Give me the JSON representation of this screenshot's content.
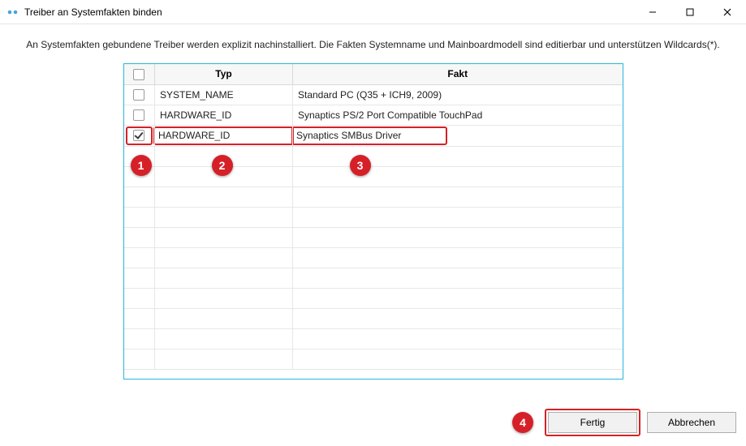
{
  "window": {
    "title": "Treiber an Systemfakten binden"
  },
  "description": "An Systemfakten gebundene Treiber werden explizit nachinstalliert. Die Fakten Systemname und Mainboardmodell sind editierbar und unterstützen Wildcards(*).",
  "columns": {
    "typ": "Typ",
    "fakt": "Fakt"
  },
  "rows": [
    {
      "checked": false,
      "typ": "SYSTEM_NAME",
      "fakt": "Standard PC (Q35 + ICH9, 2009)"
    },
    {
      "checked": false,
      "typ": "HARDWARE_ID",
      "fakt": "Synaptics PS/2 Port Compatible TouchPad"
    },
    {
      "checked": true,
      "typ": "HARDWARE_ID",
      "fakt": "Synaptics SMBus Driver"
    }
  ],
  "annotations": {
    "b1": "1",
    "b2": "2",
    "b3": "3",
    "b4": "4"
  },
  "buttons": {
    "done": "Fertig",
    "cancel": "Abbrechen"
  }
}
